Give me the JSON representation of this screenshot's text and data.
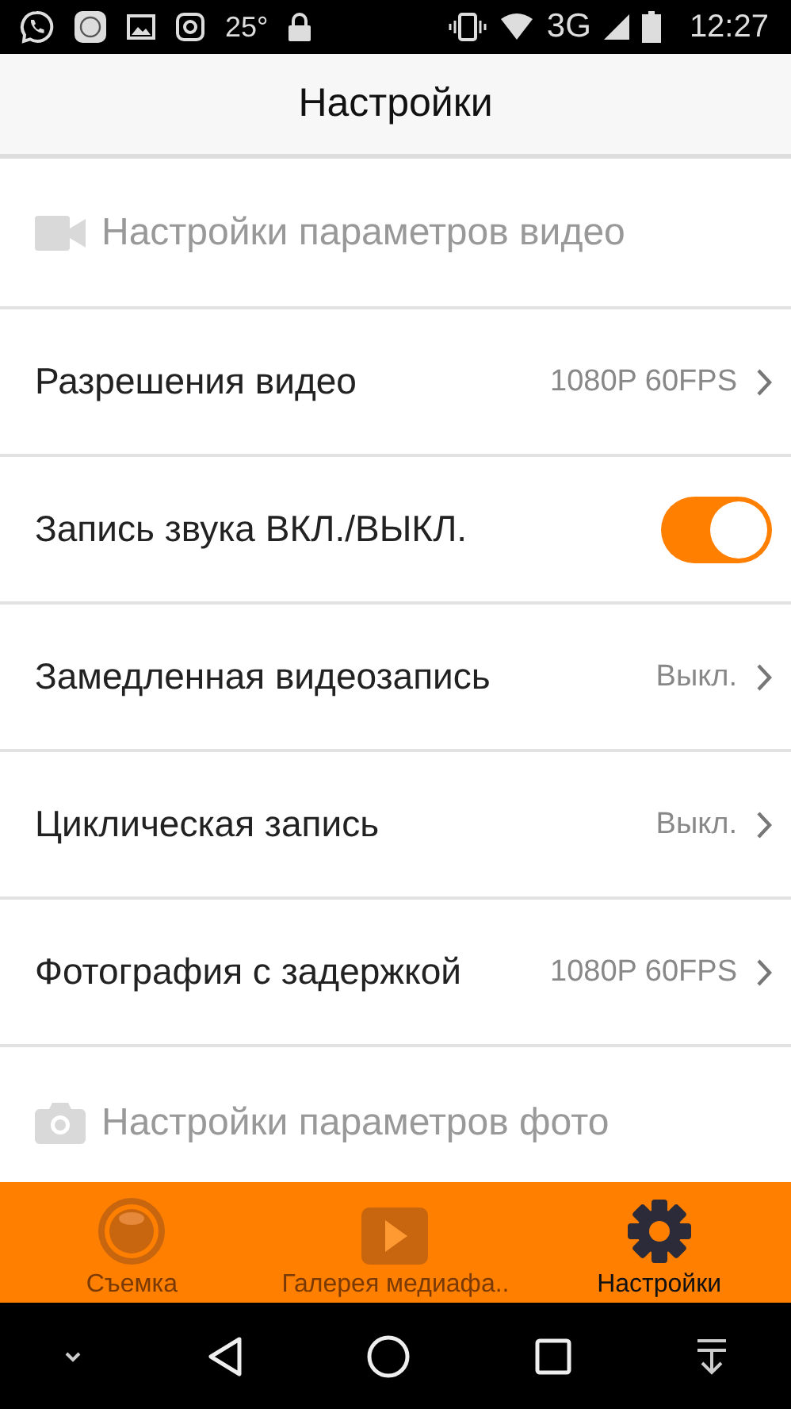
{
  "status_bar": {
    "temperature": "25°",
    "network": "3G",
    "time": "12:27"
  },
  "header": {
    "title": "Настройки"
  },
  "settings": [
    {
      "kind": "section",
      "label": "Настройки параметров видео"
    },
    {
      "kind": "value",
      "label": "Разрешения видео",
      "value": "1080P 60FPS"
    },
    {
      "kind": "toggle",
      "label": "Запись звука ВКЛ./ВЫКЛ.",
      "on": true
    },
    {
      "kind": "value",
      "label": "Замедленная видеозапись",
      "value": "Выкл."
    },
    {
      "kind": "value",
      "label": "Циклическая запись",
      "value": "Выкл."
    },
    {
      "kind": "value",
      "label": "Фотография с задержкой",
      "value": "1080P 60FPS"
    },
    {
      "kind": "section",
      "label": "Настройки параметров фото"
    }
  ],
  "tabs": [
    {
      "label": "Съемка",
      "selected": false
    },
    {
      "label": "Галерея медиафа..",
      "selected": false
    },
    {
      "label": "Настройки",
      "selected": true
    }
  ]
}
